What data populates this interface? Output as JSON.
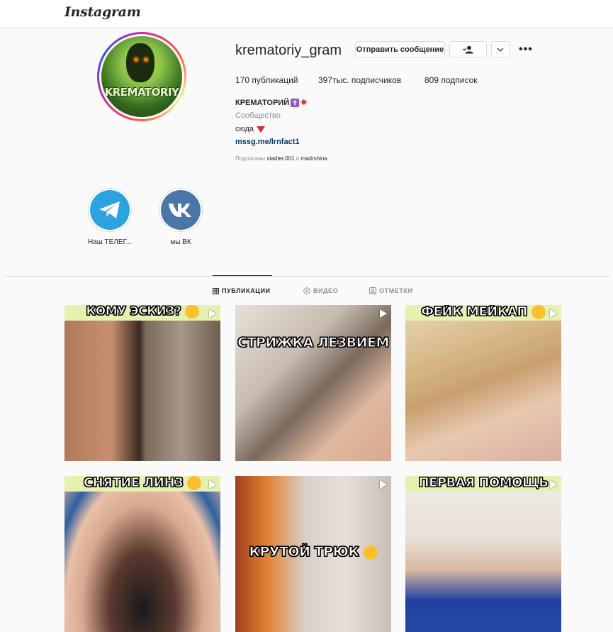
{
  "header": {
    "logo": "Instagram"
  },
  "profile": {
    "username": "krematoriy_gram",
    "avatar_text": "KREMATORIY",
    "message_button": "Отправить сообщение",
    "stats": {
      "posts_count": "170",
      "posts_label": "публикаций",
      "followers_count": "397тыс.",
      "followers_label": "подписчиков",
      "following_count": "809",
      "following_label": "подписок"
    },
    "bio": {
      "name": "КРЕМАТОРИЙ",
      "category": "Сообщество",
      "text": "сюда",
      "link": "mssg.me/lrnfact1",
      "followed_prefix": "Подписаны",
      "followed_user1": "stadler.001",
      "followed_and": "и",
      "followed_user2": "madrshina"
    }
  },
  "highlights": [
    {
      "label": "Наш ТЕЛЕГ...",
      "icon": "telegram-icon",
      "color": "#2aa3e0"
    },
    {
      "label": "мы ВК",
      "icon": "vk-icon",
      "color": "#4a76a8"
    }
  ],
  "tabs": [
    {
      "label": "ПУБЛИКАЦИИ",
      "icon": "grid-icon",
      "active": true
    },
    {
      "label": "ВИДЕО",
      "icon": "play-circle-icon",
      "active": false
    },
    {
      "label": "ОТМЕТКИ",
      "icon": "tag-icon",
      "active": false
    }
  ],
  "posts": [
    {
      "caption": "КОМУ ЭСКИЗ?"
    },
    {
      "caption": "СТРИЖКА ЛЕЗВИЕМ"
    },
    {
      "caption": "ФЕЙК МЕЙКАП"
    },
    {
      "caption": "СНЯТИЕ ЛИНЗ"
    },
    {
      "caption": "КРУТОЙ ТРЮК"
    },
    {
      "caption": "ПЕРВАЯ ПОМОЩЬ"
    }
  ]
}
